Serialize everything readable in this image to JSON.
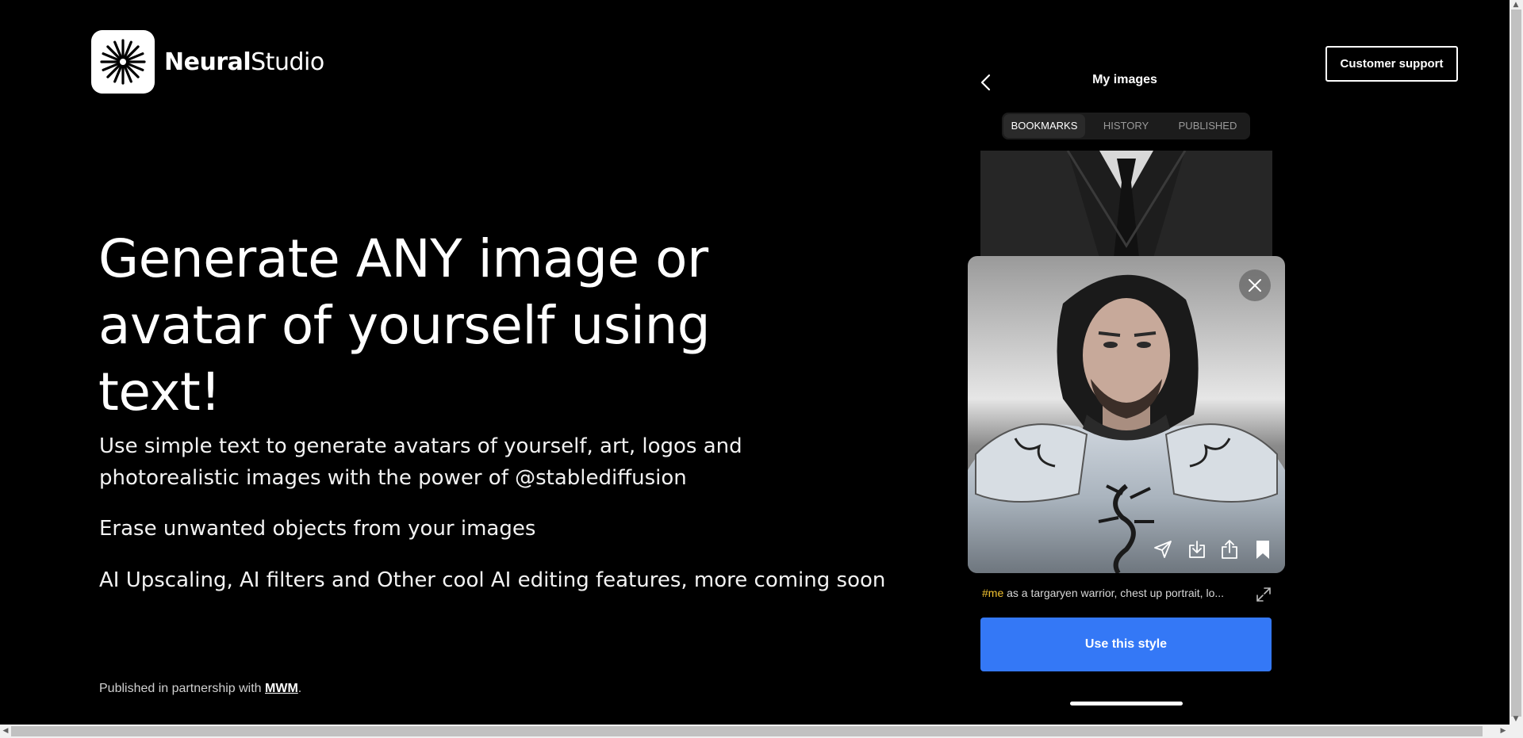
{
  "brand": {
    "name_bold": "Neural",
    "name_regular": "Studio"
  },
  "header": {
    "support_label": "Customer support"
  },
  "hero": {
    "headline": "Generate ANY image or avatar of yourself using text!",
    "paragraph_1": "Use simple text to generate avatars of yourself, art, logos and photorealistic images with the power of @stablediffusion",
    "paragraph_2": "Erase unwanted objects from your images",
    "paragraph_3": "AI Upscaling, AI filters and Other cool AI editing features, more coming soon"
  },
  "footer": {
    "prefix": "Published in partnership with ",
    "link": "MWM",
    "suffix": "."
  },
  "mockup": {
    "title": "My images",
    "tabs": [
      {
        "label": "BOOKMARKS",
        "active": true
      },
      {
        "label": "HISTORY",
        "active": false
      },
      {
        "label": "PUBLISHED",
        "active": false
      }
    ],
    "caption_tag": "#me",
    "caption_text": " as a targaryen warrior, chest up portrait, lo...",
    "cta_label": "Use this style",
    "icons": [
      "back-icon",
      "close-icon",
      "send-icon",
      "download-icon",
      "share-icon",
      "bookmark-icon",
      "expand-icon"
    ]
  },
  "colors": {
    "accent": "#3478f6",
    "caption_tag": "#f2c230",
    "background": "#000000"
  }
}
